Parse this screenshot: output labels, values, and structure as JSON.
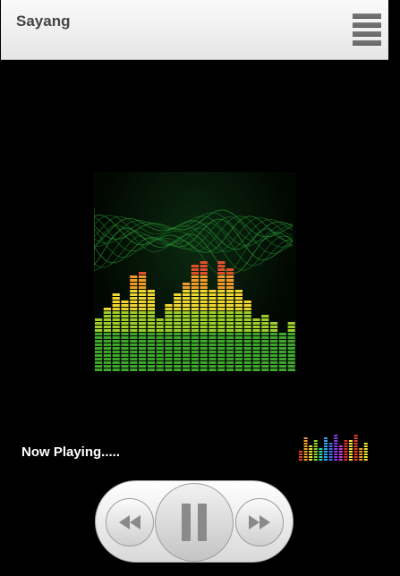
{
  "app": {
    "title": "Sayang",
    "menu_icon": "hamburger-menu-icon"
  },
  "player": {
    "status_text": "Now Playing.....",
    "state": "playing",
    "visualizer_icon": "equalizer-icon",
    "art_icon": "equalizer-album-art"
  },
  "controls": {
    "prev_icon": "rewind-icon",
    "play_pause_icon": "pause-icon",
    "next_icon": "fast-forward-icon"
  },
  "colors": {
    "background": "#000000",
    "appbar": "#eeeeee",
    "title": "#444444",
    "status_text": "#ffffff"
  }
}
